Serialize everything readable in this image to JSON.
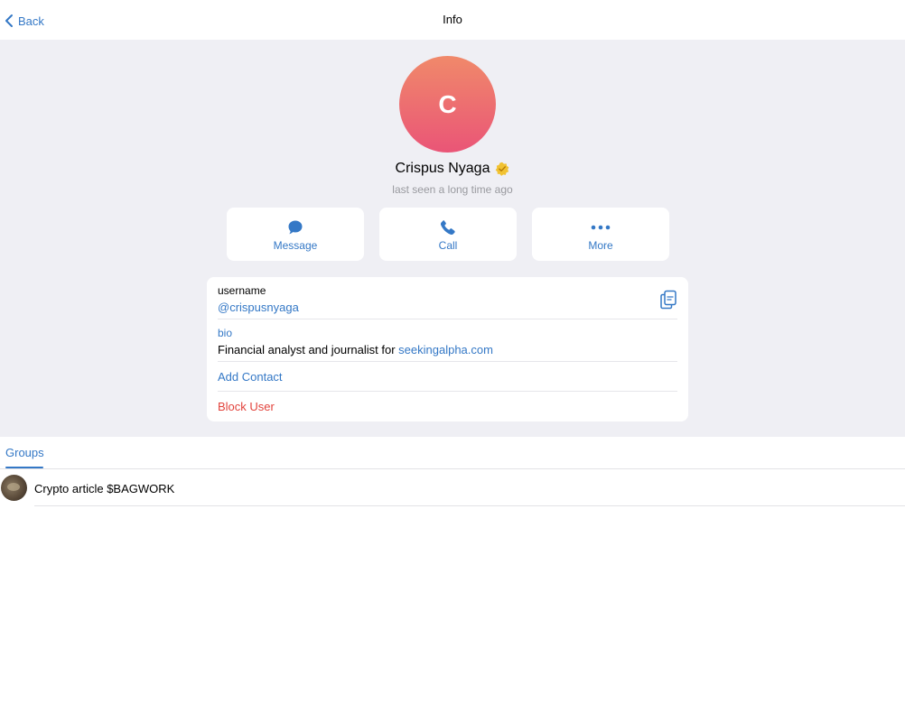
{
  "nav": {
    "back_label": "Back",
    "title": "Info"
  },
  "profile": {
    "avatar_letter": "C",
    "name": "Crispus Nyaga",
    "status": "last seen a long time ago",
    "badge_icon": "premium-badge-icon"
  },
  "actions": [
    {
      "label": "Message",
      "icon": "message-icon"
    },
    {
      "label": "Call",
      "icon": "phone-icon"
    },
    {
      "label": "More",
      "icon": "more-icon"
    }
  ],
  "info": {
    "username_label": "username",
    "username_value": "@crispusnyaga",
    "bio_label": "bio",
    "bio_text": "Financial analyst and journalist for ",
    "bio_link": "seekingalpha.com",
    "add_contact": "Add Contact",
    "block_user": "Block User"
  },
  "tabs": [
    {
      "label": "Groups"
    }
  ],
  "groups": [
    {
      "name": "Crypto article $BAGWORK"
    }
  ],
  "colors": {
    "accent": "#3478c6",
    "danger": "#e2433c",
    "avatar_top": "#f0896a",
    "avatar_bottom": "#ea5577",
    "background": "#efeff4"
  }
}
